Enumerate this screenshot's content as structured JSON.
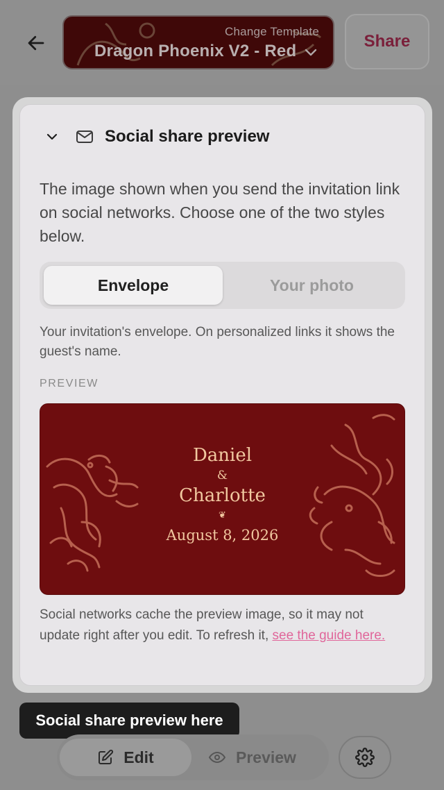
{
  "header": {
    "template": {
      "caption": "Change Template",
      "name": "Dragon Phoenix V2 - Red"
    },
    "share_label": "Share"
  },
  "panel": {
    "title": "Social share preview",
    "intro": "The image shown when you send the invitation link on social networks. Choose one of the two styles below.",
    "options": {
      "envelope": "Envelope",
      "photo": "Your photo",
      "selected": "Envelope"
    },
    "option_description": "Your invitation's envelope. On personalized links it shows the guest's name.",
    "preview_label": "PREVIEW",
    "card": {
      "name1": "Daniel",
      "ampersand": "&",
      "name2": "Charlotte",
      "ornament": "❦",
      "date": "August 8, 2026"
    },
    "cache_note": "Social networks cache the preview image, so it may not update right after you edit. To refresh it, ",
    "guide_link": "see the guide here."
  },
  "tooltip": "Social share preview here",
  "toolbar": {
    "edit_label": "Edit",
    "preview_label": "Preview"
  },
  "colors": {
    "accent": "#e0669a",
    "card_background": "#6e0d0f",
    "card_text": "#f1c8a0",
    "overlay": "#8e8e8e"
  }
}
